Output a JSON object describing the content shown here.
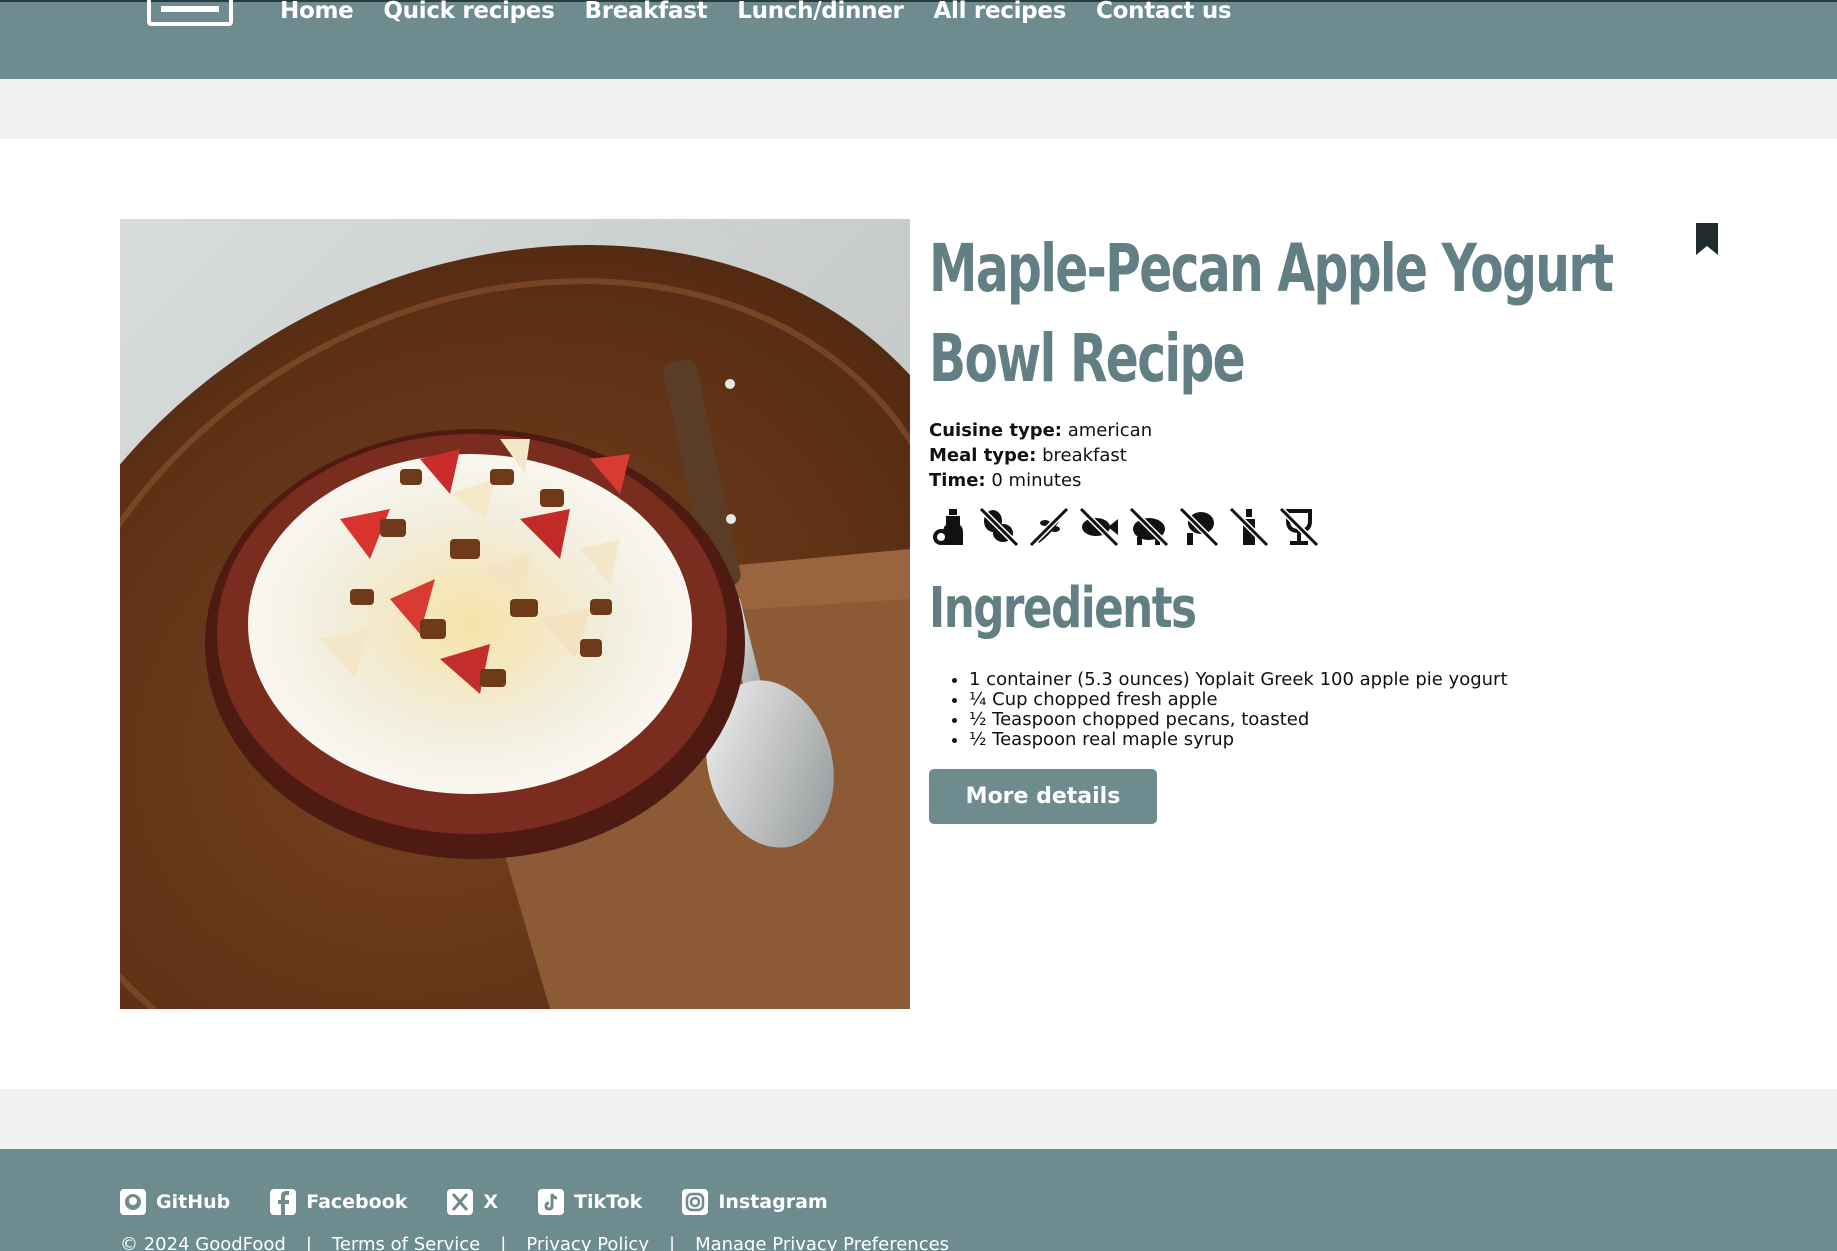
{
  "nav": {
    "links": [
      "Home",
      "Quick recipes",
      "Breakfast",
      "Lunch/dinner",
      "All recipes",
      "Contact us"
    ]
  },
  "recipe": {
    "title": "Maple-Pecan Apple Yogurt Bowl Recipe",
    "cuisine_label": "Cuisine type:",
    "cuisine_value": "american",
    "meal_label": "Meal type:",
    "meal_value": "breakfast",
    "time_label": "Time:",
    "time_value": "0 minutes",
    "diet_icons": [
      "sugar-conscious-icon",
      "no-peanut-icon",
      "no-gluten-icon",
      "no-fish-icon",
      "no-pork-icon",
      "no-egg-icon",
      "no-alcohol-icon",
      "no-wine-icon"
    ],
    "ingredients_heading": "Ingredients",
    "ingredients": [
      "1 container (5.3 ounces) Yoplait Greek 100 apple pie yogurt",
      "¼ Cup chopped fresh apple",
      "½ Teaspoon chopped pecans, toasted",
      "½ Teaspoon real maple syrup"
    ],
    "more_button": "More details"
  },
  "footer": {
    "social": [
      {
        "label": "GitHub",
        "icon": "github-icon"
      },
      {
        "label": "Facebook",
        "icon": "facebook-icon"
      },
      {
        "label": "X",
        "icon": "x-icon"
      },
      {
        "label": "TikTok",
        "icon": "tiktok-icon"
      },
      {
        "label": "Instagram",
        "icon": "instagram-icon"
      }
    ],
    "copyright": "© 2024 GoodFood",
    "terms": "Terms of Service",
    "privacy": "Privacy Policy",
    "manage": "Manage Privacy Preferences",
    "separator": "|"
  },
  "colors": {
    "header_bg": "#6e8c8f",
    "title": "#627f83",
    "band": "#f1f1f1"
  }
}
